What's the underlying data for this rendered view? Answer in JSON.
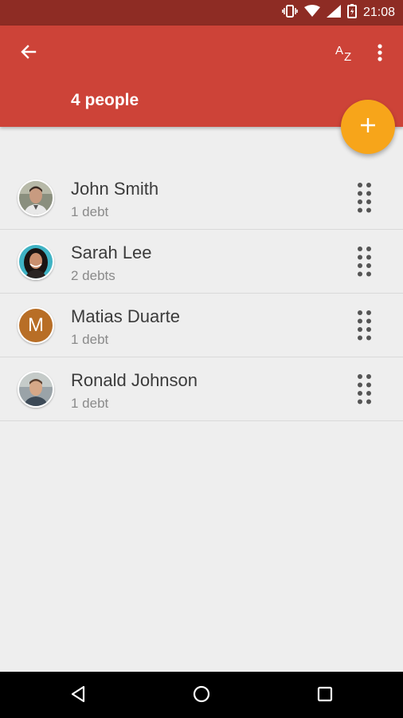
{
  "status_bar": {
    "time": "21:08"
  },
  "app_bar": {
    "title": "4 people",
    "sort_label": "AZ"
  },
  "people": [
    {
      "name": "John Smith",
      "debts": "1 debt",
      "avatar": "photo"
    },
    {
      "name": "Sarah Lee",
      "debts": "2 debts",
      "avatar": "photo"
    },
    {
      "name": "Matias Duarte",
      "debts": "1 debt",
      "avatar": "letter",
      "initial": "M"
    },
    {
      "name": "Ronald Johnson",
      "debts": "1 debt",
      "avatar": "photo"
    }
  ],
  "colors": {
    "status_bar": "#8e2c24",
    "app_bar": "#cd4338",
    "fab": "#f7a51a",
    "background": "#eeeeee",
    "avatar_letter_bg": "#b86e26"
  },
  "icons": [
    "back-arrow-icon",
    "sort-az-icon",
    "more-vert-icon",
    "plus-icon",
    "drag-handle-icon",
    "nav-back-icon",
    "nav-home-icon",
    "nav-recents-icon",
    "vibrate-icon",
    "wifi-icon",
    "signal-icon",
    "battery-icon"
  ]
}
